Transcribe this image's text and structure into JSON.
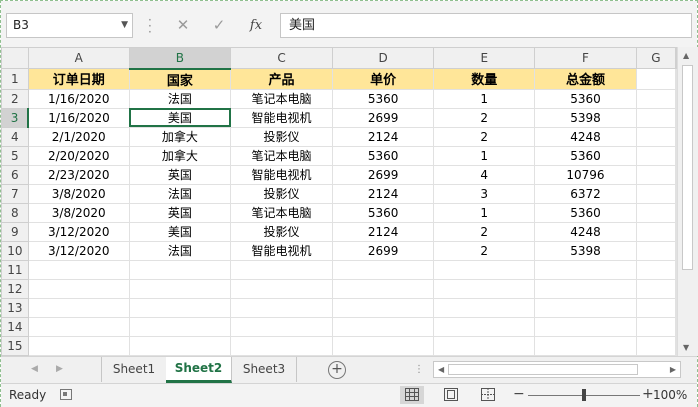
{
  "formula_bar": {
    "name_box": "B3",
    "cancel_icon": "✕",
    "enter_icon": "✓",
    "function_icon": "fx",
    "formula_value": "美国"
  },
  "columns": [
    "A",
    "B",
    "C",
    "D",
    "E",
    "F",
    "G"
  ],
  "rows": [
    {
      "num": "1",
      "cells": [
        "订单日期",
        "国家",
        "产品",
        "单价",
        "数量",
        "总金额"
      ]
    },
    {
      "num": "2",
      "cells": [
        "1/16/2020",
        "法国",
        "笔记本电脑",
        "5360",
        "1",
        "5360"
      ]
    },
    {
      "num": "3",
      "cells": [
        "1/16/2020",
        "美国",
        "智能电视机",
        "2699",
        "2",
        "5398"
      ]
    },
    {
      "num": "4",
      "cells": [
        "2/1/2020",
        "加拿大",
        "投影仪",
        "2124",
        "2",
        "4248"
      ]
    },
    {
      "num": "5",
      "cells": [
        "2/20/2020",
        "加拿大",
        "笔记本电脑",
        "5360",
        "1",
        "5360"
      ]
    },
    {
      "num": "6",
      "cells": [
        "2/23/2020",
        "英国",
        "智能电视机",
        "2699",
        "4",
        "10796"
      ]
    },
    {
      "num": "7",
      "cells": [
        "3/8/2020",
        "法国",
        "投影仪",
        "2124",
        "3",
        "6372"
      ]
    },
    {
      "num": "8",
      "cells": [
        "3/8/2020",
        "英国",
        "笔记本电脑",
        "5360",
        "1",
        "5360"
      ]
    },
    {
      "num": "9",
      "cells": [
        "3/12/2020",
        "美国",
        "投影仪",
        "2124",
        "2",
        "4248"
      ]
    },
    {
      "num": "10",
      "cells": [
        "3/12/2020",
        "法国",
        "智能电视机",
        "2699",
        "2",
        "5398"
      ]
    },
    {
      "num": "11",
      "cells": [
        "",
        "",
        "",
        "",
        "",
        ""
      ]
    },
    {
      "num": "12",
      "cells": [
        "",
        "",
        "",
        "",
        "",
        ""
      ]
    },
    {
      "num": "13",
      "cells": [
        "",
        "",
        "",
        "",
        "",
        ""
      ]
    },
    {
      "num": "14",
      "cells": [
        "",
        "",
        "",
        "",
        "",
        ""
      ]
    },
    {
      "num": "15",
      "cells": [
        "",
        "",
        "",
        "",
        "",
        ""
      ]
    }
  ],
  "sheets": {
    "tab1": "Sheet1",
    "tab2": "Sheet2",
    "tab3": "Sheet3",
    "add_icon": "+",
    "active": "Sheet2"
  },
  "status": {
    "ready": "Ready",
    "zoom": "100%",
    "zoom_minus": "−",
    "zoom_plus": "+"
  },
  "colors": {
    "accent": "#217346",
    "header_fill": "#ffe699"
  }
}
